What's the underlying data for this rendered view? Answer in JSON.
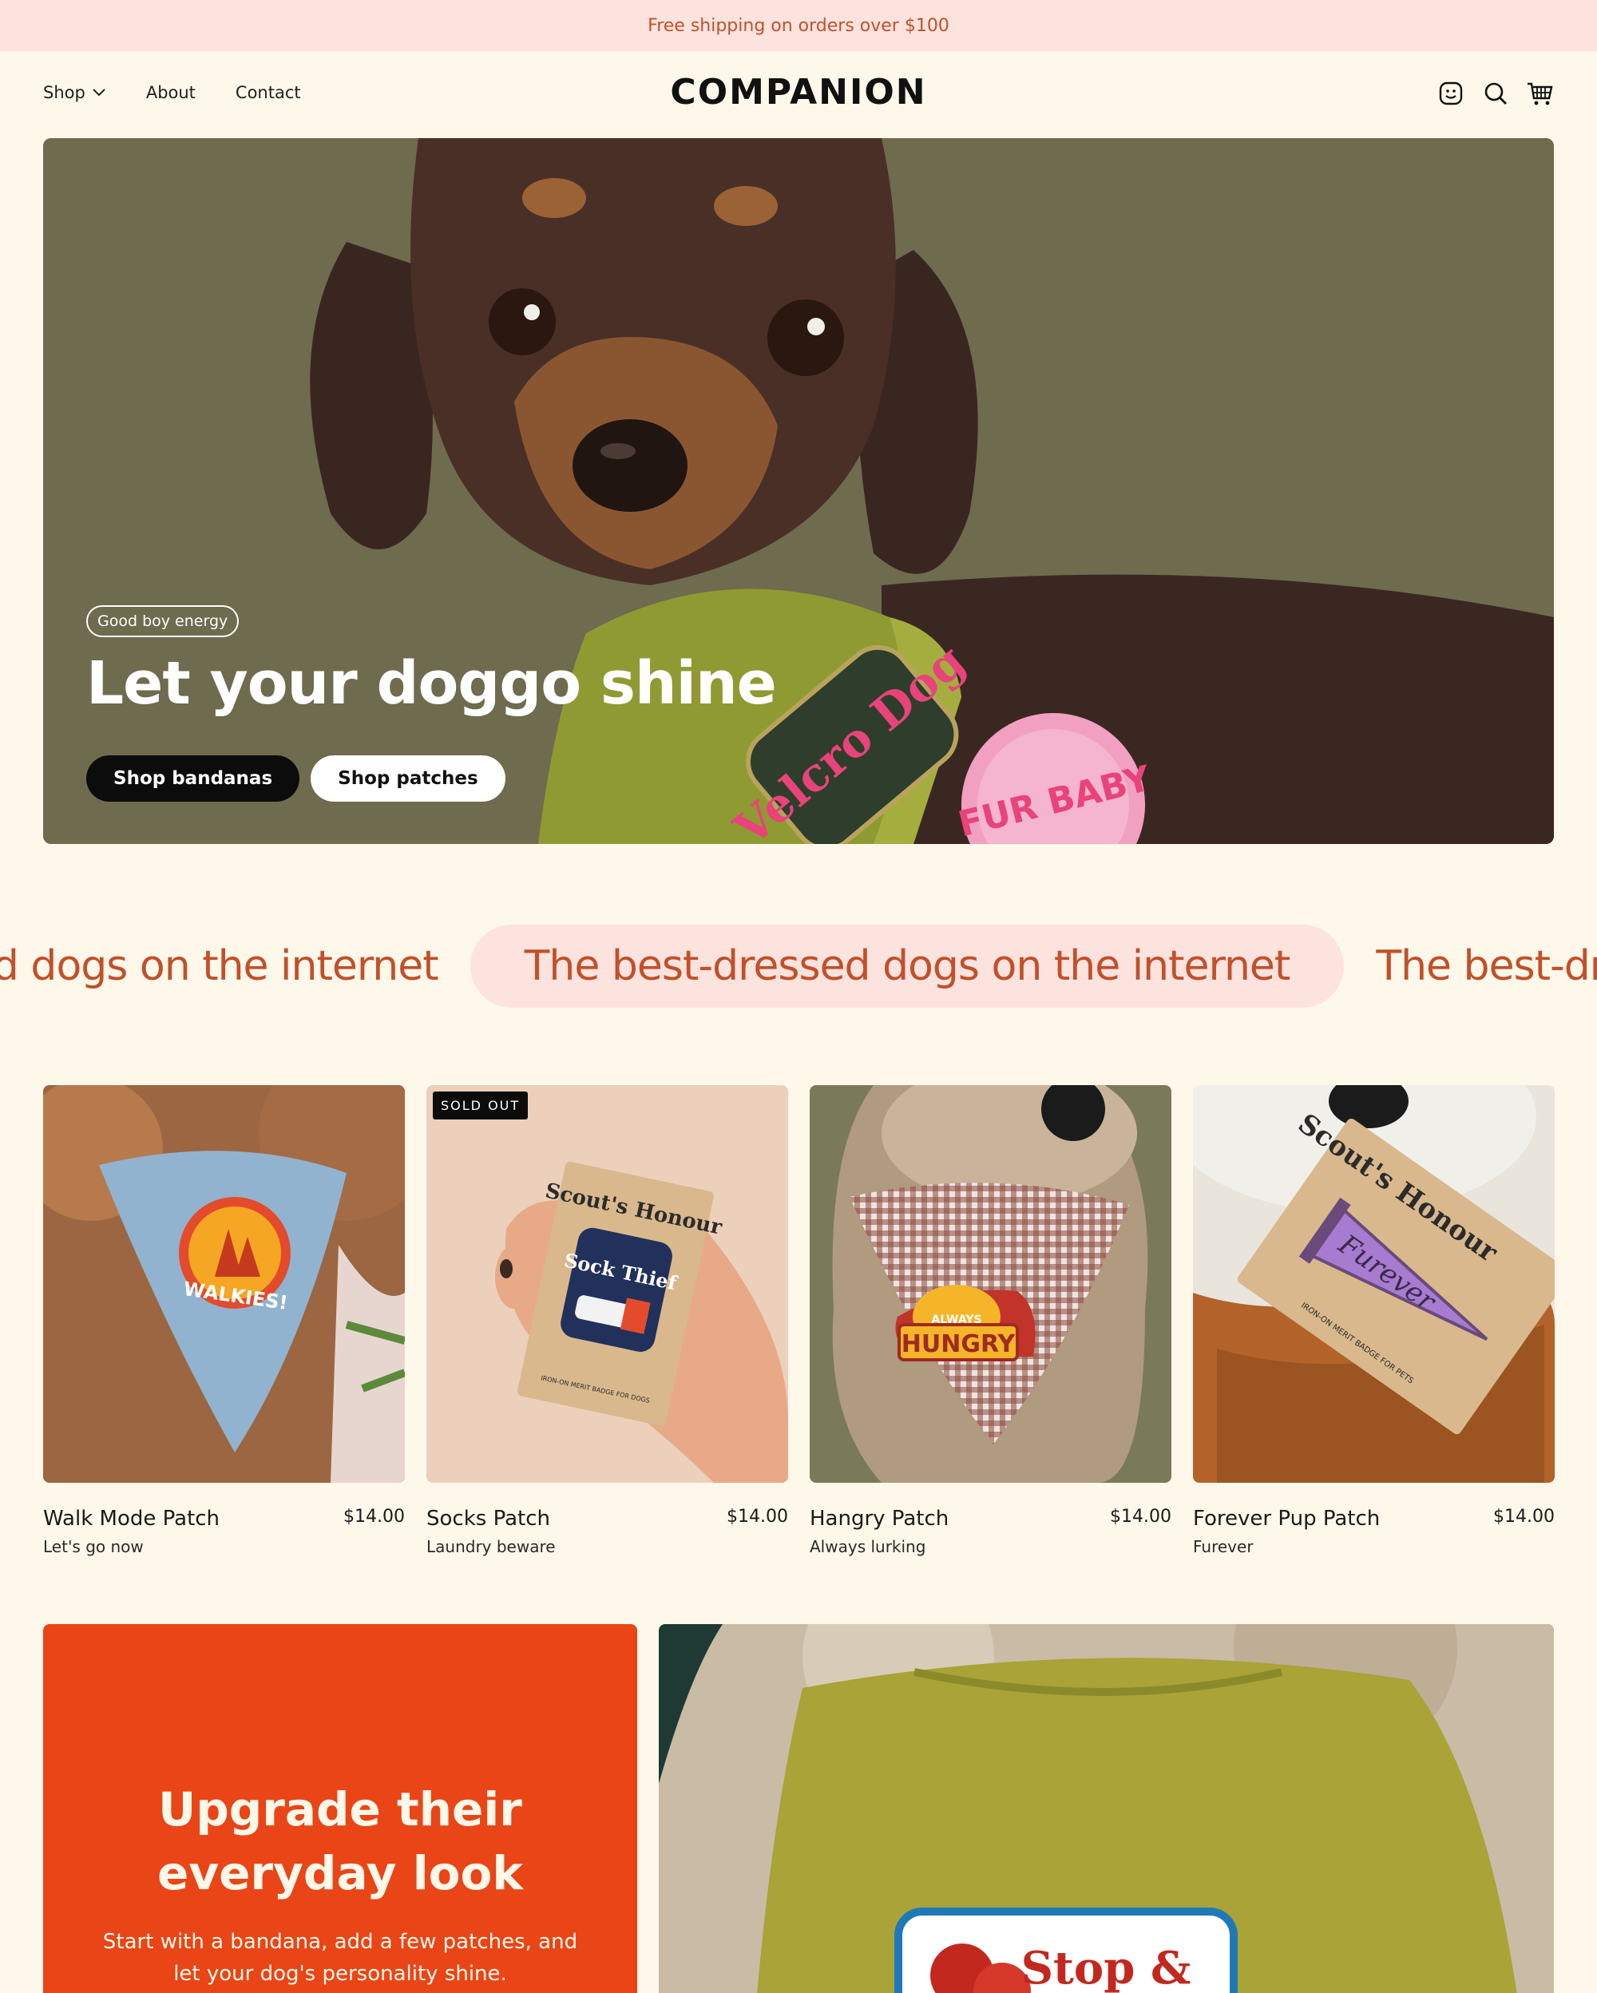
{
  "announcement": {
    "text": "Free shipping on orders over $100"
  },
  "header": {
    "logo": "COMPANION",
    "nav": [
      {
        "label": "Shop",
        "has_dropdown": true
      },
      {
        "label": "About"
      },
      {
        "label": "Contact"
      }
    ],
    "icons": [
      "account-icon",
      "search-icon",
      "cart-icon"
    ]
  },
  "hero": {
    "tag": "Good boy energy",
    "title": "Let your doggo shine",
    "buttons": [
      {
        "label": "Shop bandanas",
        "style": "dark"
      },
      {
        "label": "Shop patches",
        "style": "light"
      }
    ],
    "patch_text_1": "Velcro Dog",
    "patch_text_2": "FUR BABY"
  },
  "marquee": {
    "items": [
      "The best-dressed dogs on the internet",
      "The best-dressed dogs on the internet",
      "The best-dressed dogs on the internet"
    ]
  },
  "products": [
    {
      "name": "Walk Mode Patch",
      "price": "$14.00",
      "subtitle": "Let's go now",
      "badge": "",
      "patch_label": "WALKIES!"
    },
    {
      "name": "Socks Patch",
      "price": "$14.00",
      "subtitle": "Laundry beware",
      "badge": "SOLD OUT",
      "patch_label": "Sock Thief",
      "card_label": "Scout's Honour",
      "card_footer": "IRON-ON MERIT BADGE FOR DOGS"
    },
    {
      "name": "Hangry Patch",
      "price": "$14.00",
      "subtitle": "Always lurking",
      "badge": "",
      "patch_label": "HUNGRY",
      "patch_top": "ALWAYS"
    },
    {
      "name": "Forever Pup Patch",
      "price": "$14.00",
      "subtitle": "Furever",
      "badge": "",
      "patch_label": "Furever",
      "card_label": "Scout's Honour",
      "card_footer": "IRON-ON MERIT BADGE FOR PETS"
    }
  ],
  "promo": {
    "title_line1": "Upgrade their",
    "title_line2": "everyday look",
    "text": "Start with a bandana, add a few patches, and let your dog's personality shine.",
    "photo_patch_text": "Stop &"
  },
  "colors": {
    "background": "#fdf8ea",
    "announcement_bg": "#fce3de",
    "accent_text": "#c2502a",
    "promo_bg": "#ea4516",
    "hero_bg": "#6e6b4f"
  }
}
